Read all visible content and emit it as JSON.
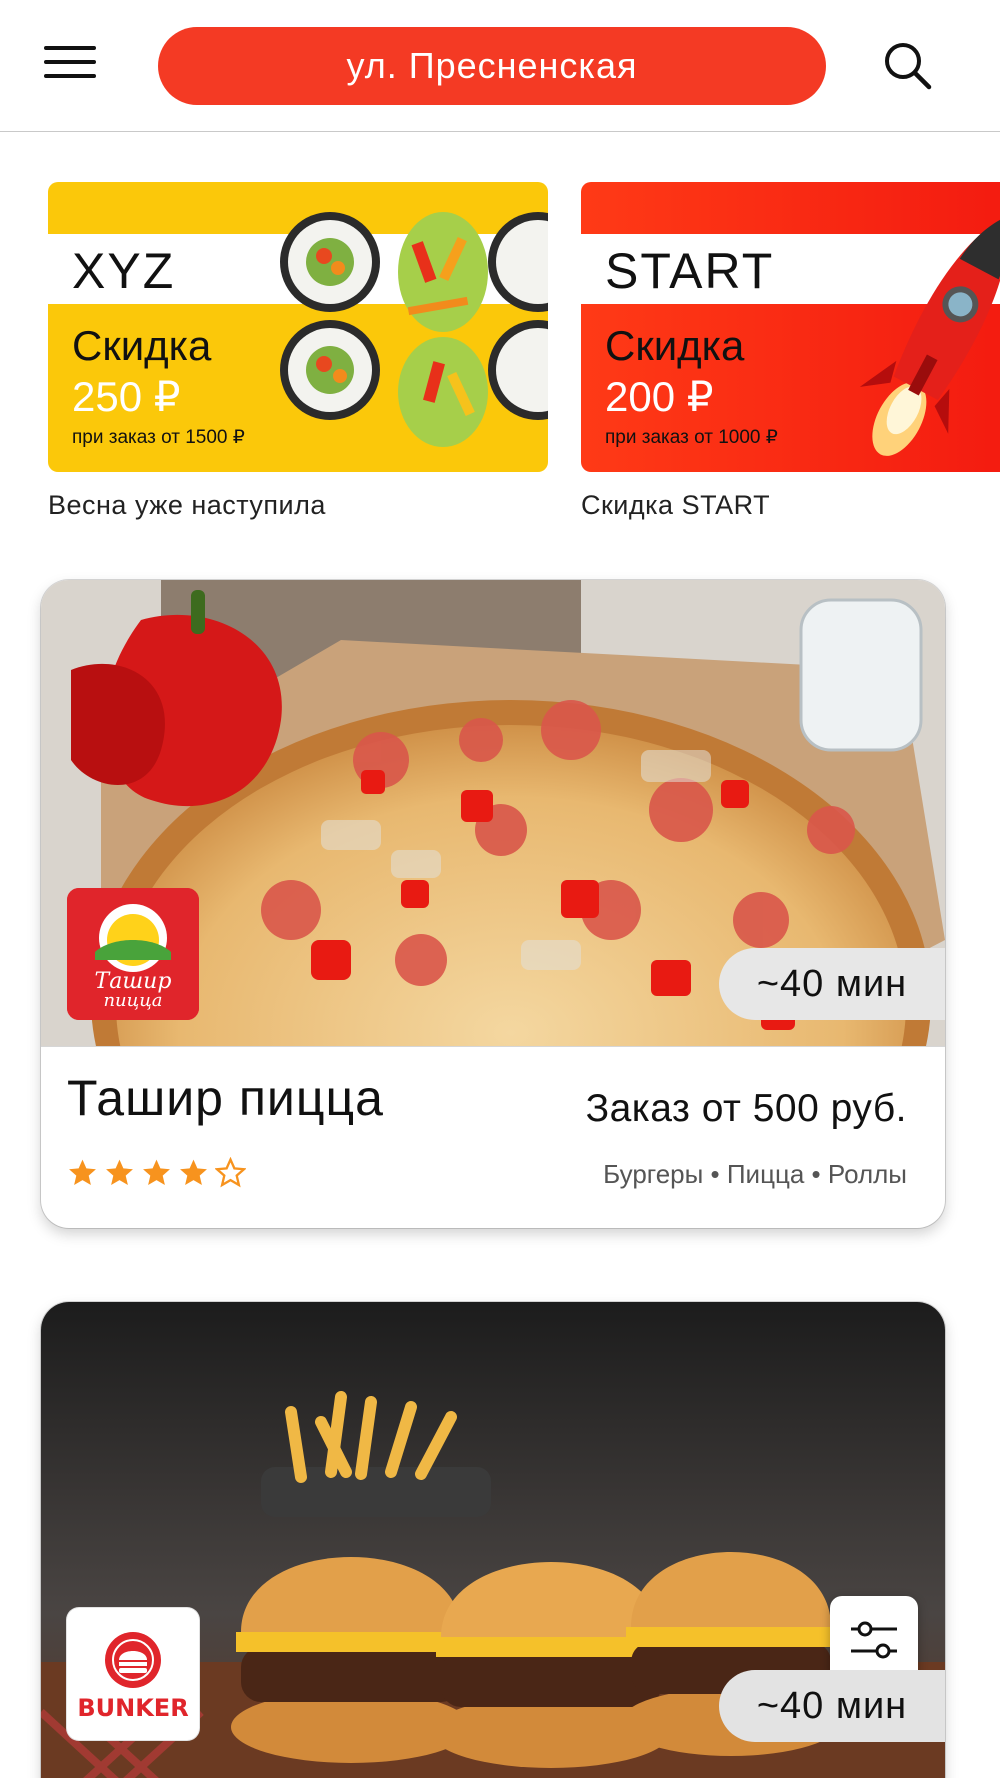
{
  "header": {
    "address": "ул. Пресненская"
  },
  "promos": [
    {
      "code": "XYZ",
      "title": "Скидка",
      "amount": "250 ₽",
      "condition": "при заказ от 1500 ₽",
      "caption": "Весна уже наступила",
      "color": "#fbc80a"
    },
    {
      "code": "START",
      "title": "Скидка",
      "amount": "200 ₽",
      "condition": "при заказ от 1000 ₽",
      "caption": "Скидка START",
      "color": "#f4260f"
    }
  ],
  "restaurants": [
    {
      "name": "Ташир пицца",
      "min_order": "Заказ от 500 руб.",
      "tags": "Бургеры • Пицца • Роллы",
      "delivery_time": "~40 мин",
      "rating": 4,
      "rating_max": 5,
      "logo_text_line1": "Ташир",
      "logo_text_line2": "пицца"
    },
    {
      "name": "BUNKER",
      "delivery_time": "~40 мин",
      "logo_text": "BUNKER"
    }
  ],
  "colors": {
    "accent": "#f43a24",
    "star": "#f7931e"
  }
}
